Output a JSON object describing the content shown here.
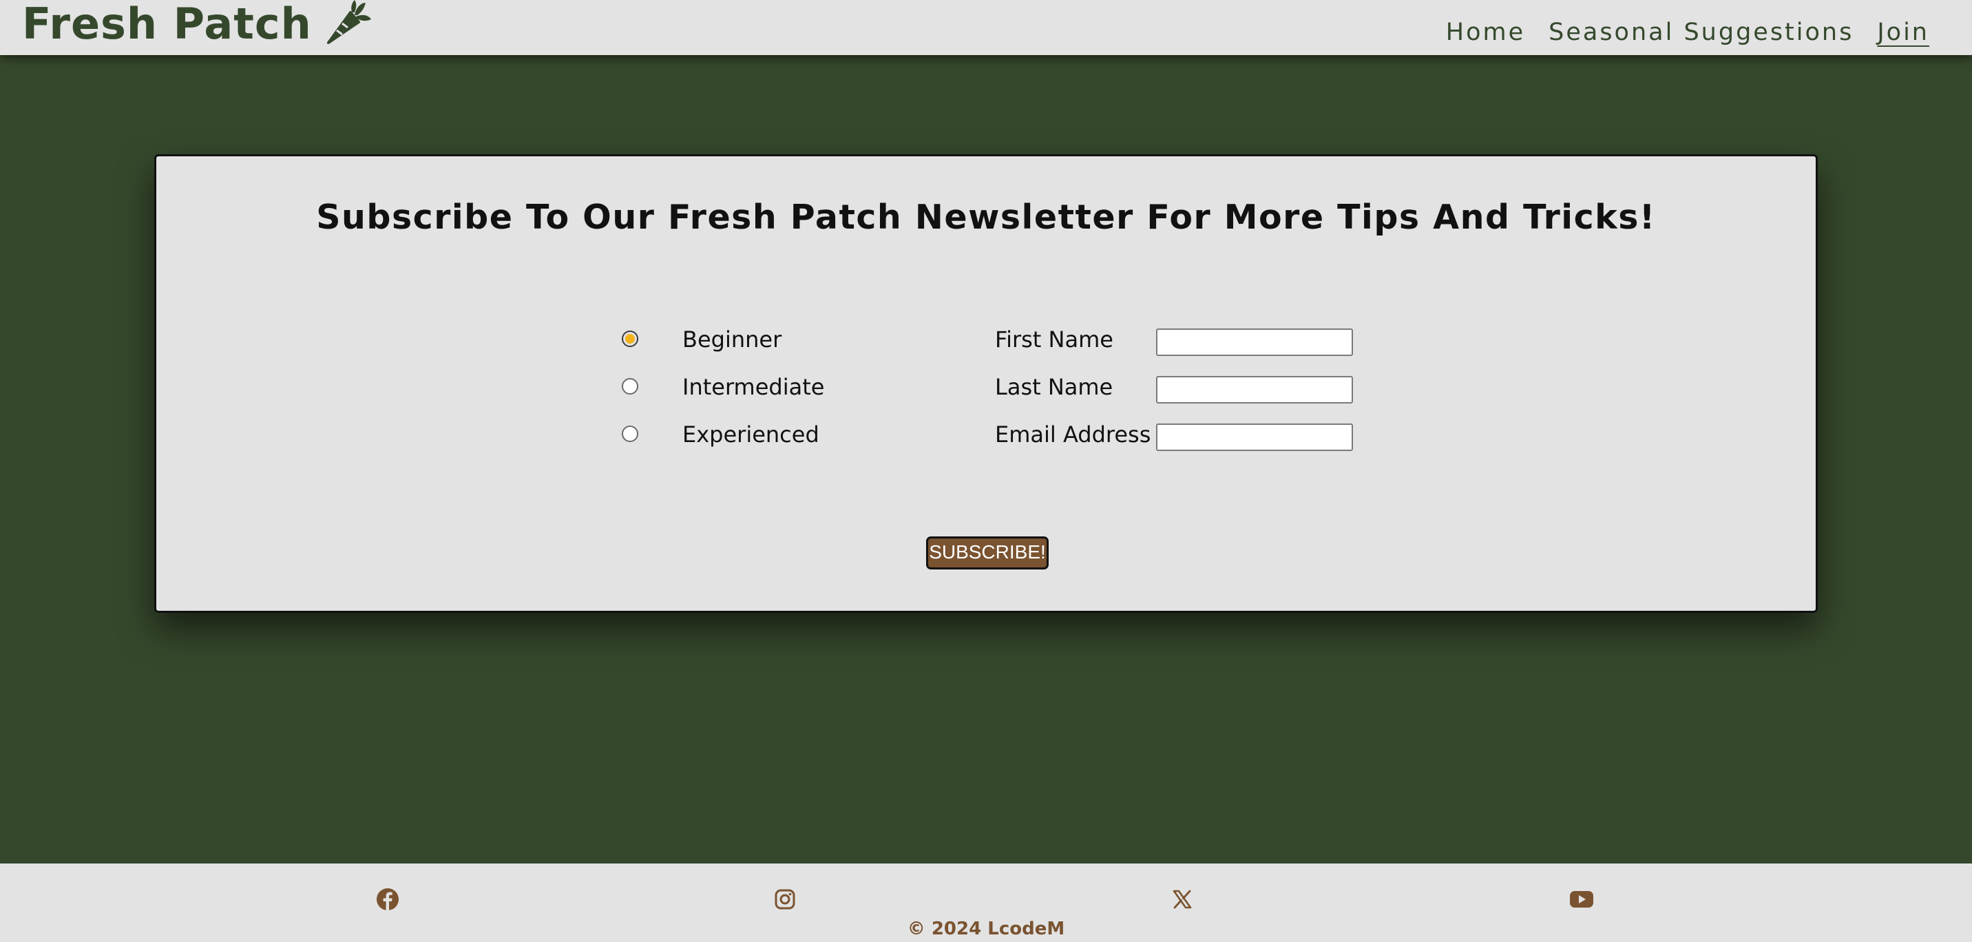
{
  "brand": {
    "name": "Fresh Patch",
    "icon": "carrot-icon",
    "color": "#35482c"
  },
  "nav": {
    "items": [
      {
        "label": "Home",
        "active": false
      },
      {
        "label": "Seasonal Suggestions",
        "active": false
      },
      {
        "label": "Join",
        "active": true
      }
    ]
  },
  "form": {
    "title": "Subscribe To Our Fresh Patch Newsletter For More Tips And Tricks!",
    "levels": [
      {
        "label": "Beginner",
        "checked": true
      },
      {
        "label": "Intermediate",
        "checked": false
      },
      {
        "label": "Experienced",
        "checked": false
      }
    ],
    "fields": [
      {
        "label": "First Name",
        "value": ""
      },
      {
        "label": "Last Name",
        "value": ""
      },
      {
        "label": "Email Address",
        "value": ""
      }
    ],
    "submit_label": "SUBSCRIBE!"
  },
  "footer": {
    "social_icons": [
      "facebook-icon",
      "instagram-icon",
      "x-icon",
      "youtube-icon"
    ],
    "copyright": "© 2024 LcodeM"
  },
  "colors": {
    "background": "#35482c",
    "panel": "#e3e3e3",
    "accent_brown": "#7a5330",
    "radio_checked": "#f2b21a"
  }
}
